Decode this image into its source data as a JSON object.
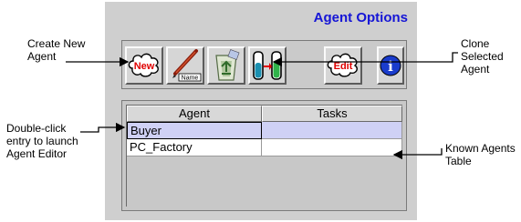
{
  "panel": {
    "title": "Agent Options"
  },
  "toolbar": {
    "new_label": "New",
    "name_label": "Name",
    "edit_label": "Edit",
    "info_label": "i"
  },
  "table": {
    "columns": [
      "Agent",
      "Tasks"
    ],
    "rows": [
      {
        "agent": "Buyer",
        "tasks": ""
      },
      {
        "agent": "PC_Factory",
        "tasks": ""
      }
    ]
  },
  "callouts": {
    "create_new": [
      "Create New",
      "Agent"
    ],
    "clone": [
      "Clone",
      "Selected",
      "Agent"
    ],
    "double_click": [
      "Double-click",
      "entry to launch",
      "Agent Editor"
    ],
    "known": [
      "Known Agents",
      "Table"
    ]
  },
  "colors": {
    "title": "#1515d6",
    "new_red": "#e00000",
    "selected_row": "#cfd1f5",
    "info_blue": "#1a3ccc"
  }
}
